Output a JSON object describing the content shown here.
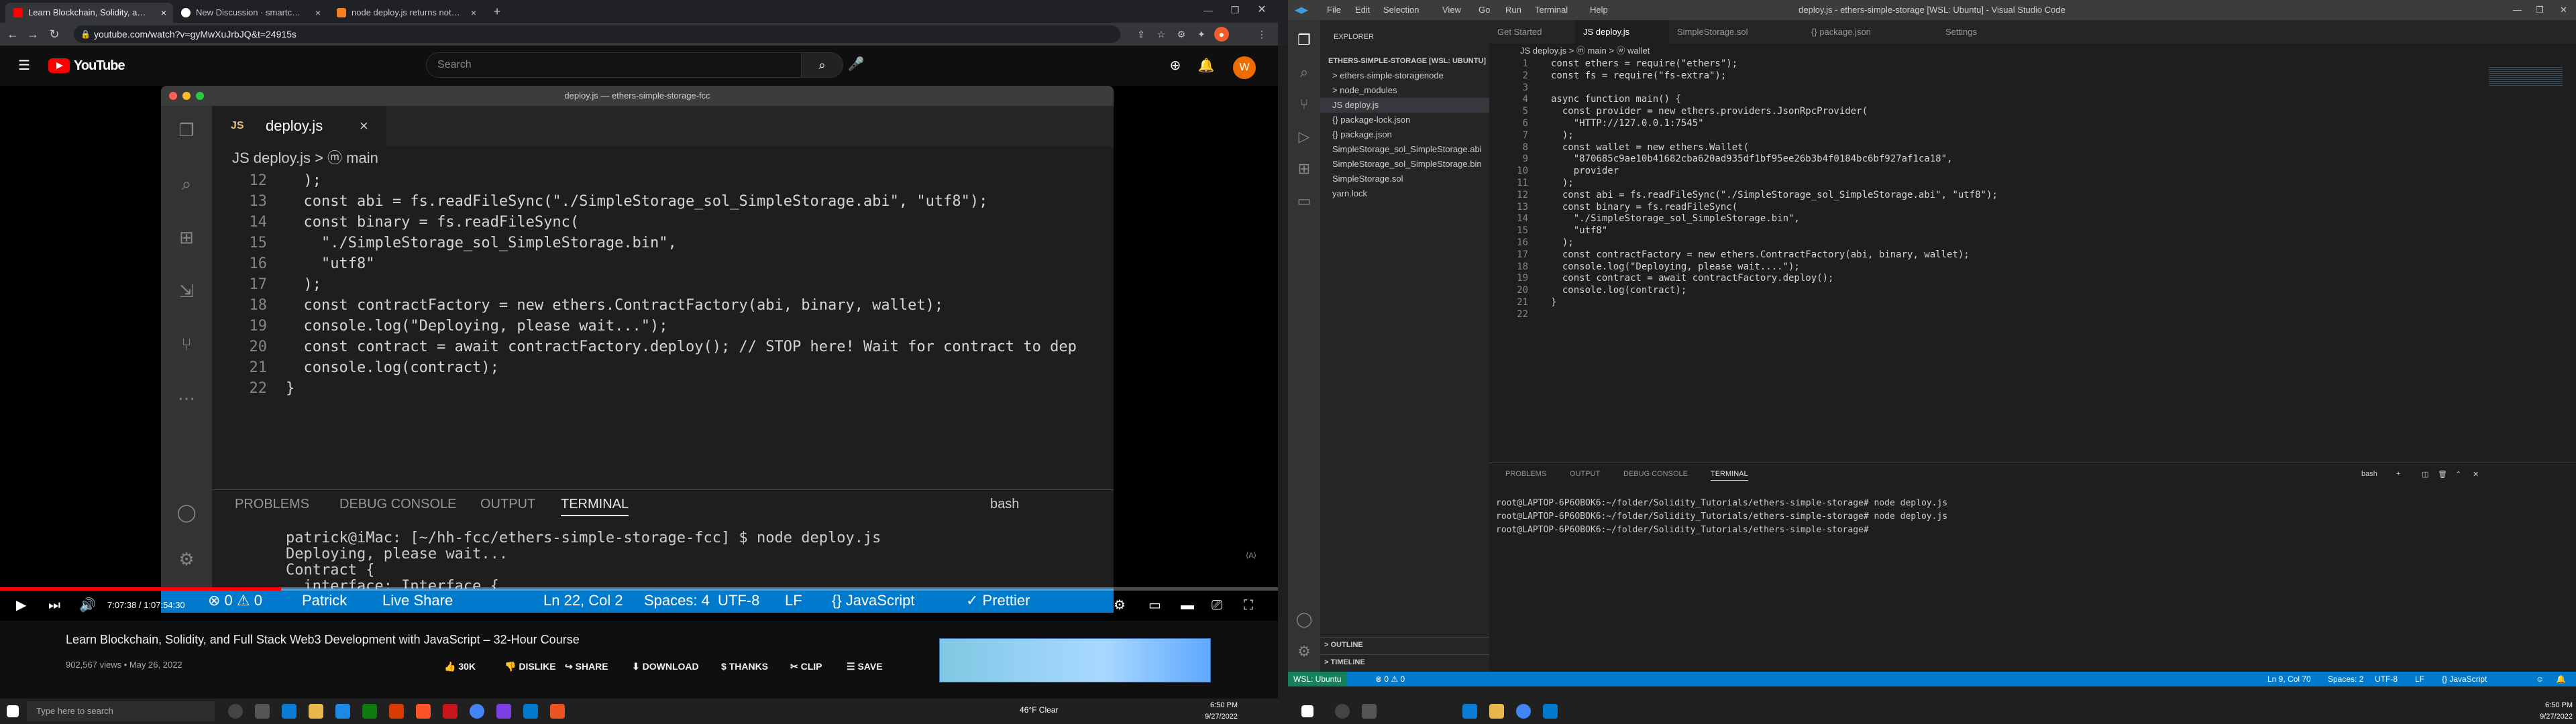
{
  "browser": {
    "tabs": [
      {
        "label": "Learn Blockchain, Solidity, and Fu",
        "favicon_color": "#ff0000"
      },
      {
        "label": "New Discussion · smartcontractk",
        "favicon_color": "#ffffff"
      },
      {
        "label": "node deploy.js returns nothing",
        "favicon_color": "#f48024"
      }
    ],
    "url": "youtube.com/watch?v=gyMwXuJrbJQ&t=24915s"
  },
  "youtube": {
    "logo_text": "YouTube",
    "search_placeholder": "Search",
    "avatar_letter": "W",
    "video": {
      "title": "Learn Blockchain, Solidity, and Full Stack Web3 Development with JavaScript – 32-Hour Course",
      "meta": "902,567 views • May 26, 2022",
      "time": "7:07:38 / 1:07:54:30",
      "progress": 0.22,
      "actions": [
        "30K",
        "DISLIKE",
        "SHARE",
        "DOWNLOAD",
        "THANKS",
        "CLIP",
        "SAVE"
      ]
    },
    "embedded_vscode": {
      "window_title": "deploy.js — ethers-simple-storage-fcc",
      "tab_label": "deploy.js",
      "breadcrumb": "JS deploy.js > ⓜ main",
      "code": [
        {
          "n": "12",
          "t": "  );"
        },
        {
          "n": "13",
          "t": "  const abi = fs.readFileSync(\"./SimpleStorage_sol_SimpleStorage.abi\", \"utf8\");"
        },
        {
          "n": "14",
          "t": "  const binary = fs.readFileSync("
        },
        {
          "n": "15",
          "t": "    \"./SimpleStorage_sol_SimpleStorage.bin\","
        },
        {
          "n": "16",
          "t": "    \"utf8\""
        },
        {
          "n": "17",
          "t": "  );"
        },
        {
          "n": "18",
          "t": "  const contractFactory = new ethers.ContractFactory(abi, binary, wallet);"
        },
        {
          "n": "19",
          "t": "  console.log(\"Deploying, please wait...\");"
        },
        {
          "n": "20",
          "t": "  const contract = await contractFactory.deploy(); // STOP here! Wait for contract to dep"
        },
        {
          "n": "21",
          "t": "  console.log(contract);"
        },
        {
          "n": "22",
          "t": "}"
        }
      ],
      "panel_tabs": [
        "PROBLEMS",
        "DEBUG CONSOLE",
        "OUTPUT",
        "TERMINAL"
      ],
      "shell": "bash",
      "terminal": "patrick@iMac: [~/hh-fcc/ethers-simple-storage-fcc] $ node deploy.js\nDeploying, please wait...\nContract {\n  interface: Interface {\n    fragments: [\n      [FunctionFragment],\n      [FunctionFragment],\n      [FunctionFragment],\n      [FunctionFragment],",
      "status": [
        "⊗ 0 ⚠ 0",
        "Patrick",
        "Live Share",
        "Ln 22, Col 2",
        "Spaces: 4",
        "UTF-8",
        "LF",
        "{} JavaScript",
        "✓ Prettier"
      ]
    }
  },
  "vscode": {
    "window_title": "deploy.js - ethers-simple-storage [WSL: Ubuntu] - Visual Studio Code",
    "menu": [
      "File",
      "Edit",
      "Selection",
      "View",
      "Go",
      "Run",
      "Terminal",
      "Help"
    ],
    "explorer_title": "EXPLORER",
    "root": "ETHERS-SIMPLE-STORAGE [WSL: UBUNTU]",
    "files": [
      {
        "name": "> ethers-simple-storagenode",
        "indent": 1
      },
      {
        "name": "> node_modules",
        "indent": 1
      },
      {
        "name": "JS deploy.js",
        "indent": 1,
        "selected": true
      },
      {
        "name": "{} package-lock.json",
        "indent": 1
      },
      {
        "name": "{} package.json",
        "indent": 1
      },
      {
        "name": "SimpleStorage_sol_SimpleStorage.abi",
        "indent": 1
      },
      {
        "name": "SimpleStorage_sol_SimpleStorage.bin",
        "indent": 1
      },
      {
        "name": "SimpleStorage.sol",
        "indent": 1
      },
      {
        "name": "yarn.lock",
        "indent": 1
      }
    ],
    "outline": "> OUTLINE",
    "timeline": "> TIMELINE",
    "tabs": [
      "Get Started",
      "JS deploy.js",
      "SimpleStorage.sol",
      "{} package.json",
      "Settings"
    ],
    "breadcrumb": "JS deploy.js > ⓜ main > ⓦ wallet",
    "code": [
      {
        "n": "1",
        "t": "const ethers = require(\"ethers\");"
      },
      {
        "n": "2",
        "t": "const fs = require(\"fs-extra\");"
      },
      {
        "n": "3",
        "t": ""
      },
      {
        "n": "4",
        "t": "async function main() {"
      },
      {
        "n": "5",
        "t": "  const provider = new ethers.providers.JsonRpcProvider("
      },
      {
        "n": "6",
        "t": "    \"HTTP://127.0.0.1:7545\""
      },
      {
        "n": "7",
        "t": "  );"
      },
      {
        "n": "8",
        "t": "  const wallet = new ethers.Wallet("
      },
      {
        "n": "9",
        "t": "    \"870685c9ae10b41682cba620ad935df1bf95ee26b3b4f0184bc6bf927af1ca18\","
      },
      {
        "n": "10",
        "t": "    provider"
      },
      {
        "n": "11",
        "t": "  );"
      },
      {
        "n": "12",
        "t": "  const abi = fs.readFileSync(\"./SimpleStorage_sol_SimpleStorage.abi\", \"utf8\");"
      },
      {
        "n": "13",
        "t": "  const binary = fs.readFileSync("
      },
      {
        "n": "14",
        "t": "    \"./SimpleStorage_sol_SimpleStorage.bin\","
      },
      {
        "n": "15",
        "t": "    \"utf8\""
      },
      {
        "n": "16",
        "t": "  );"
      },
      {
        "n": "17",
        "t": "  const contractFactory = new ethers.ContractFactory(abi, binary, wallet);"
      },
      {
        "n": "18",
        "t": "  console.log(\"Deploying, please wait....\");"
      },
      {
        "n": "19",
        "t": "  const contract = await contractFactory.deploy();"
      },
      {
        "n": "20",
        "t": "  console.log(contract);"
      },
      {
        "n": "21",
        "t": "}"
      },
      {
        "n": "22",
        "t": ""
      }
    ],
    "panel_tabs": [
      "PROBLEMS",
      "OUTPUT",
      "DEBUG CONSOLE",
      "TERMINAL"
    ],
    "shell": "bash",
    "terminal": "root@LAPTOP-6P6OBOK6:~/folder/Solidity_Tutorials/ethers-simple-storage# node deploy.js\nroot@LAPTOP-6P6OBOK6:~/folder/Solidity_Tutorials/ethers-simple-storage# node deploy.js\nroot@LAPTOP-6P6OBOK6:~/folder/Solidity_Tutorials/ethers-simple-storage# ",
    "status_left": [
      "WSL: Ubuntu",
      "⊗ 0 ⚠ 0"
    ],
    "status_right": [
      "Ln 9, Col 70",
      "Spaces: 2",
      "UTF-8",
      "LF",
      "{} JavaScript"
    ]
  },
  "taskbar": {
    "search_placeholder": "Type here to search",
    "weather": "46°F  Clear",
    "time": "6:50 PM",
    "date": "9/27/2022"
  },
  "colors": {
    "accent": "#007acc",
    "youtube_red": "#ff0000",
    "wsl_green": "#16825d"
  }
}
